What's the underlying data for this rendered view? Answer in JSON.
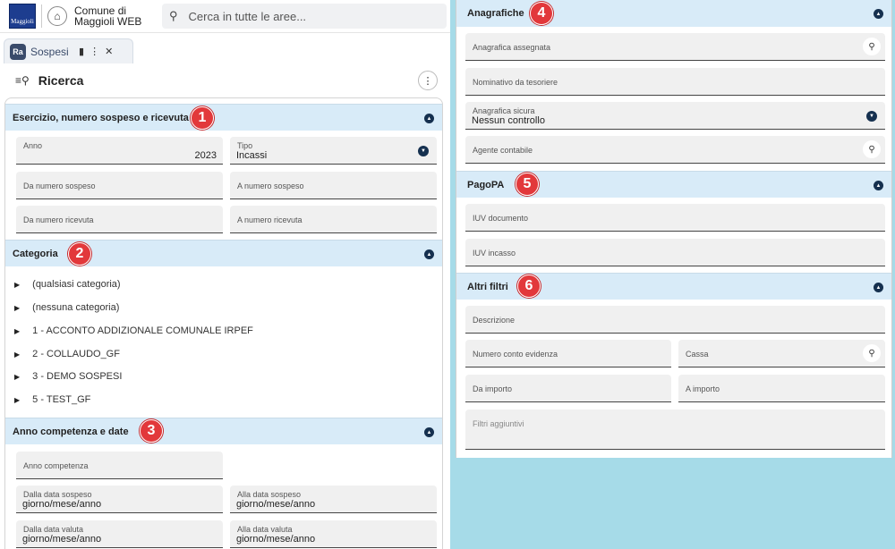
{
  "app": {
    "name": "Comune di Maggioli WEB",
    "logo_text": "Maggioli"
  },
  "search": {
    "placeholder": "Cerca in tutte le aree..."
  },
  "tab": {
    "badge": "Ra",
    "label": "Sospesi"
  },
  "page": {
    "title": "Ricerca"
  },
  "markers": [
    "1",
    "2",
    "3",
    "4",
    "5",
    "6"
  ],
  "sections": {
    "esercizio": {
      "title": "Esercizio, numero sospeso e ricevuta",
      "anno_label": "Anno",
      "anno_value": "2023",
      "tipo_label": "Tipo",
      "tipo_value": "Incassi",
      "da_numero_sospeso": "Da numero sospeso",
      "a_numero_sospeso": "A numero sospeso",
      "da_numero_ricevuta": "Da numero ricevuta",
      "a_numero_ricevuta": "A numero ricevuta"
    },
    "categoria": {
      "title": "Categoria",
      "items": [
        "(qualsiasi categoria)",
        "(nessuna categoria)",
        "1 - ACCONTO ADDIZIONALE COMUNALE IRPEF",
        "2 - COLLAUDO_GF",
        "3 - DEMO SOSPESI",
        "5 - TEST_GF"
      ]
    },
    "anno_competenza": {
      "title": "Anno competenza e date",
      "anno_competenza": "Anno competenza",
      "dalla_data_sospeso": "Dalla data sospeso",
      "alla_data_sospeso": "Alla data sospeso",
      "dalla_data_valuta": "Dalla data valuta",
      "alla_data_valuta": "Alla data valuta",
      "date_placeholder": "giorno/mese/anno"
    },
    "anagrafiche": {
      "title": "Anagrafiche",
      "anagrafica_assegnata": "Anagrafica assegnata",
      "nominativo_tesoriere": "Nominativo da tesoriere",
      "anagrafica_sicura_label": "Anagrafica sicura",
      "anagrafica_sicura_value": "Nessun controllo",
      "agente_contabile": "Agente contabile"
    },
    "pagopa": {
      "title": "PagoPA",
      "iuv_documento": "IUV documento",
      "iuv_incasso": "IUV incasso"
    },
    "altri_filtri": {
      "title": "Altri filtri",
      "descrizione": "Descrizione",
      "numero_conto_evidenza": "Numero conto evidenza",
      "cassa": "Cassa",
      "da_importo": "Da importo",
      "a_importo": "A importo",
      "filtri_aggiuntivi": "Filtri aggiuntivi"
    }
  }
}
